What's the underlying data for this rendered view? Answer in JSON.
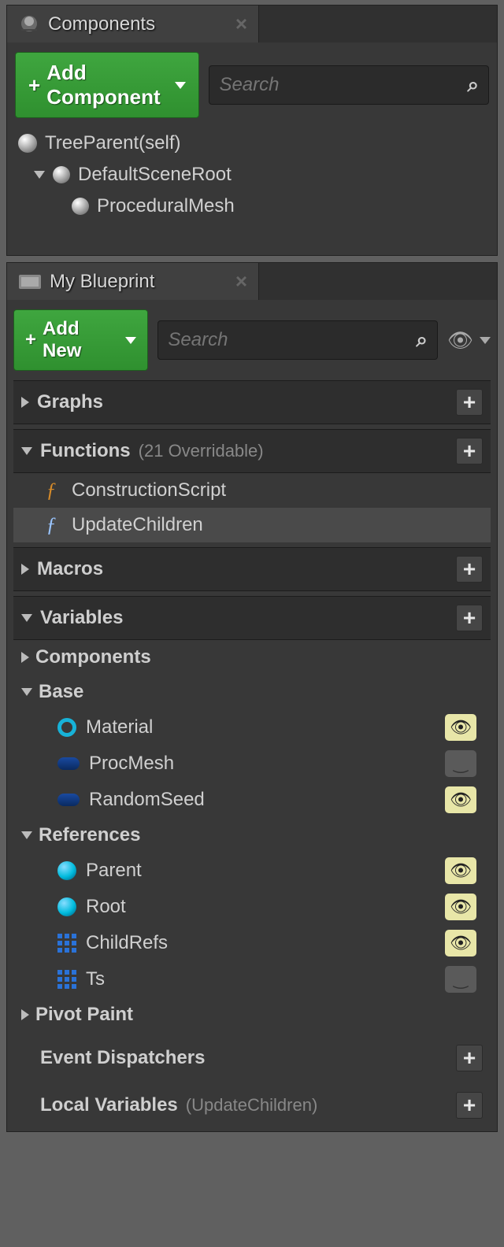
{
  "components": {
    "tab_title": "Components",
    "add_button": "Add Component",
    "search_placeholder": "Search",
    "tree": {
      "root": "TreeParent(self)",
      "scene_root": "DefaultSceneRoot",
      "proc_mesh": "ProceduralMesh"
    }
  },
  "blueprint": {
    "tab_title": "My Blueprint",
    "add_button": "Add New",
    "search_placeholder": "Search",
    "sections": {
      "graphs": {
        "label": "Graphs"
      },
      "functions": {
        "label": "Functions",
        "sub": "(21 Overridable)",
        "items": {
          "cs": "ConstructionScript",
          "uc": "UpdateChildren"
        }
      },
      "macros": {
        "label": "Macros"
      },
      "variables": {
        "label": "Variables",
        "cats": {
          "components": "Components",
          "base": "Base",
          "references": "References",
          "pivot": "Pivot Paint"
        },
        "base": {
          "material": "Material",
          "procmesh": "ProcMesh",
          "randseed": "RandomSeed"
        },
        "refs": {
          "parent": "Parent",
          "root": "Root",
          "childrefs": "ChildRefs",
          "ts": "Ts"
        }
      },
      "event_dispatchers": {
        "label": "Event Dispatchers"
      },
      "local_vars": {
        "label": "Local Variables",
        "sub": "(UpdateChildren)"
      }
    }
  }
}
